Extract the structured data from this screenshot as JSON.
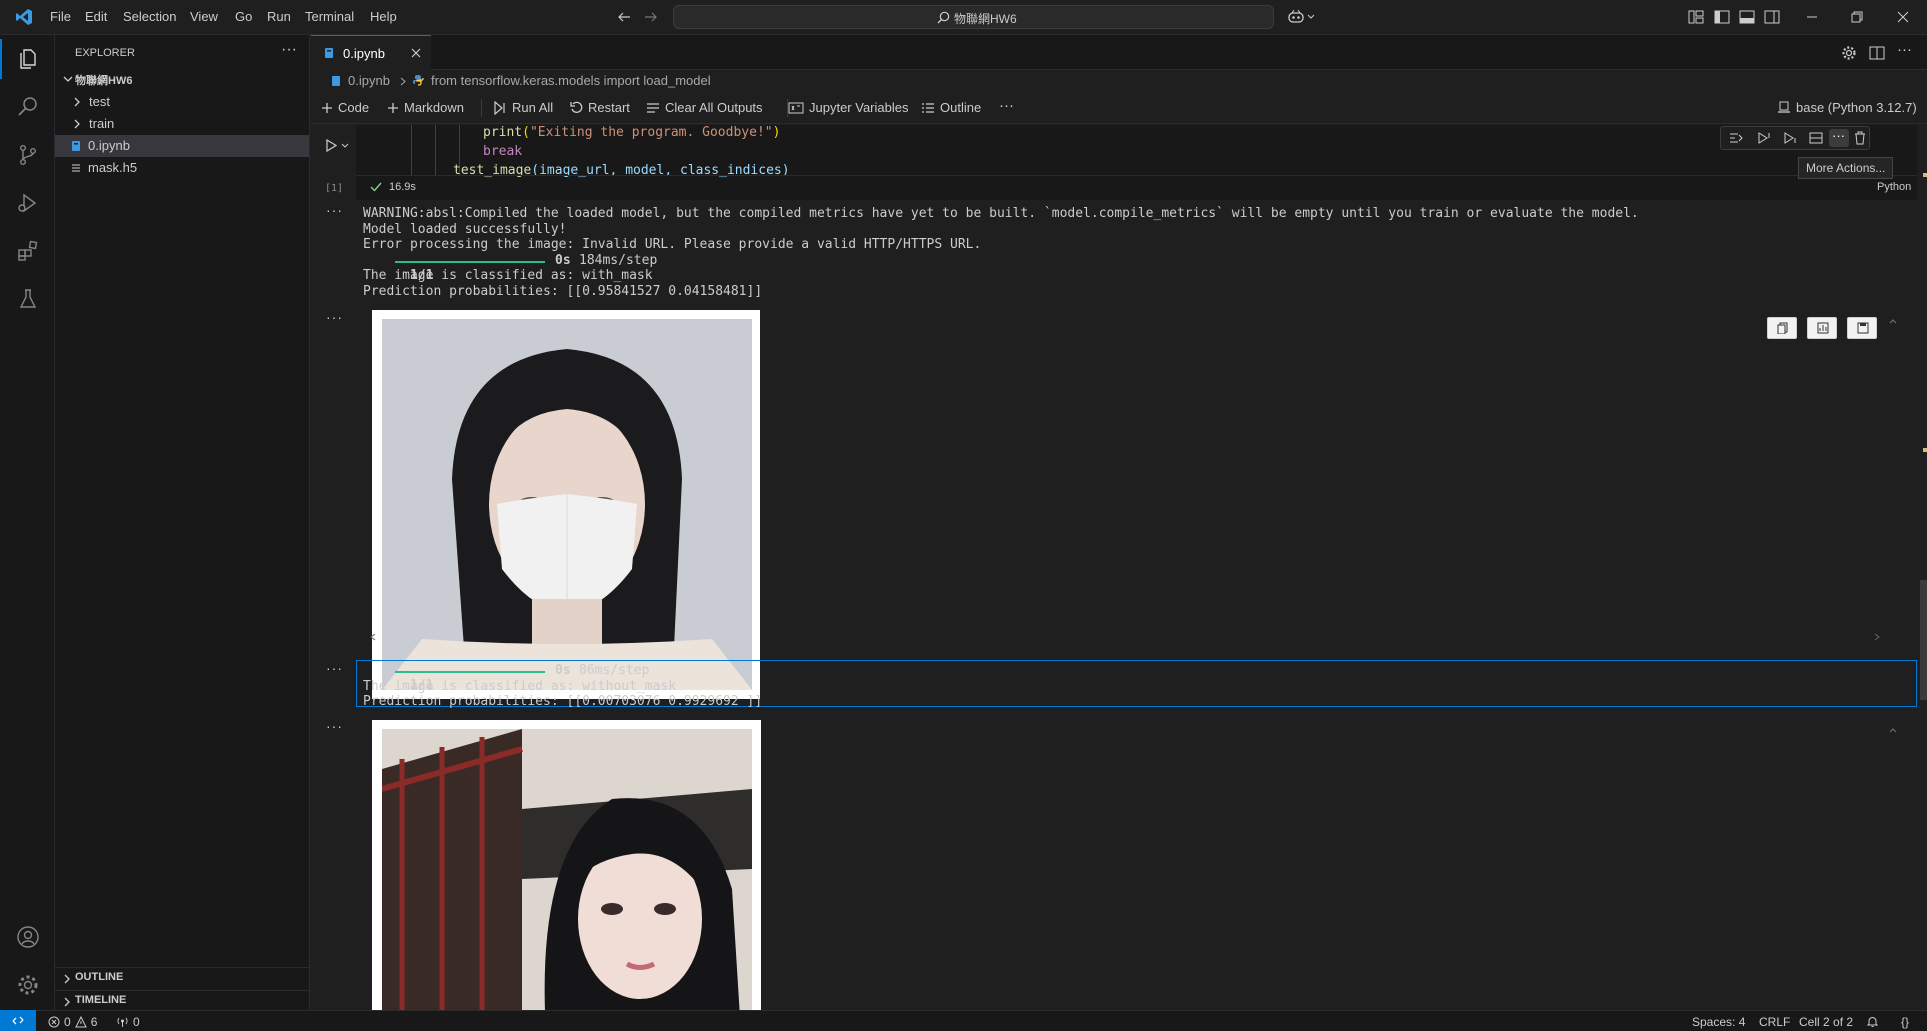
{
  "titlebar": {
    "menu": [
      "File",
      "Edit",
      "Selection",
      "View",
      "Go",
      "Run",
      "Terminal",
      "Help"
    ],
    "search_text": "物聯網HW6"
  },
  "sidebar": {
    "title": "EXPLORER",
    "folder": "物聯網HW6",
    "items": [
      {
        "label": "test",
        "type": "folder"
      },
      {
        "label": "train",
        "type": "folder"
      },
      {
        "label": "0.ipynb",
        "type": "notebook",
        "selected": true
      },
      {
        "label": "mask.h5",
        "type": "file"
      }
    ],
    "outline": "OUTLINE",
    "timeline": "TIMELINE"
  },
  "editor": {
    "tab": "0.ipynb",
    "breadcrumb": {
      "file": "0.ipynb",
      "symbol": "from tensorflow.keras.models import load_model"
    },
    "toolbar": {
      "code": "Code",
      "markdown": "Markdown",
      "run_all": "Run All",
      "restart": "Restart",
      "clear": "Clear All Outputs",
      "variables": "Jupyter Variables",
      "outline": "Outline",
      "kernel": "base (Python 3.12.7)"
    },
    "cell": {
      "line1": "print(\"Exiting the program. Goodbye!\")",
      "line2": "break",
      "line3_fn": "test_image",
      "line3_args": "(image_url, model, class_indices)",
      "exec_count": "[1]",
      "duration": "16.9s",
      "language": "Python",
      "tooltip": "More Actions..."
    },
    "output1": [
      "WARNING:absl:Compiled the loaded model, but the compiled metrics have yet to be built. `model.compile_metrics` will be empty until you train or evaluate the model.",
      "Model loaded successfully!",
      "Error processing the image: Invalid URL. Please provide a valid HTTP/HTTPS URL."
    ],
    "progress1": {
      "label": "1/1",
      "time": "0s",
      "rate": "184ms/step",
      "fill": 1.0
    },
    "output1_tail": [
      "The image is classified as: with_mask",
      "Prediction probabilities: [[0.95841527 0.04158481]]"
    ],
    "progress2": {
      "label": "1/1",
      "time": "0s",
      "rate": "86ms/step",
      "fill": 1.0
    },
    "output2_tail": [
      "The image is classified as: without_mask",
      "Prediction probabilities: [[0.00703076 0.9929692 ]]"
    ]
  },
  "statusbar": {
    "errors": "0",
    "warnings": "6",
    "ports": "0",
    "spaces": "Spaces: 4",
    "eol": "CRLF",
    "cell": "Cell 2 of 2"
  },
  "colors": {
    "accent": "#0078d4",
    "progress": "#2bbd8e",
    "string": "#ce9178",
    "keyword": "#c586c0",
    "function": "#dcdcaa"
  }
}
